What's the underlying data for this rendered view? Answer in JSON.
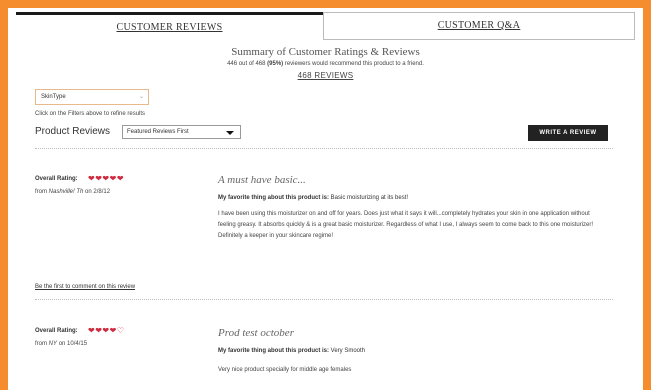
{
  "tabs": [
    {
      "label": "CUSTOMER REVIEWS"
    },
    {
      "label": "CUSTOMER Q&A"
    }
  ],
  "summary": {
    "title": "Summary of Customer Ratings & Reviews",
    "recommend_count": "446 out of 468",
    "recommend_pct": "(95%)",
    "recommend_rest": "reviewers would recommend this product to a friend.",
    "reviews_link": "468 REVIEWS"
  },
  "filters": {
    "skin_type": "SkinType",
    "hint": "Click on the Filters above to refine results"
  },
  "toolbar": {
    "product_reviews_label": "Product Reviews",
    "sort_value": "Featured Reviews First",
    "write_review": "WRITE A REVIEW"
  },
  "colors": {
    "accent_orange": "#f58d2f",
    "heart_red": "#d02a3e",
    "button_dark": "#222222"
  },
  "reviews": [
    {
      "rating_label": "Overall Rating:",
      "rating": 5,
      "hearts": "❤❤❤❤❤",
      "from_prefix": "from",
      "author": "Nashville! Th",
      "on_word": "on",
      "date": "2/8/12",
      "title": "A must have basic...",
      "fav_label": "My favorite thing about this product is:",
      "fav_value": "Basic moisturizing at its best!",
      "body": "I have been using this moisturizer on and off for years. Does just what it says it will...completely hydrates your skin in one application without feeling greasy. It absorbs quickly & is a great basic moisturizer. Regardless of what I use, I always seem to come back to this one moisturizer! Definitely a keeper in your skincare regime!",
      "comment_link": "Be the first to comment on this review"
    },
    {
      "rating_label": "Overall Rating:",
      "rating": 4,
      "hearts": "❤❤❤❤♡",
      "from_prefix": "from",
      "author": "NY",
      "on_word": "on",
      "date": "10/4/15",
      "title": "Prod test october",
      "fav_label": "My favorite thing about this product is:",
      "fav_value": "Very Smooth",
      "body": "Very nice product specially for middle age females"
    }
  ]
}
